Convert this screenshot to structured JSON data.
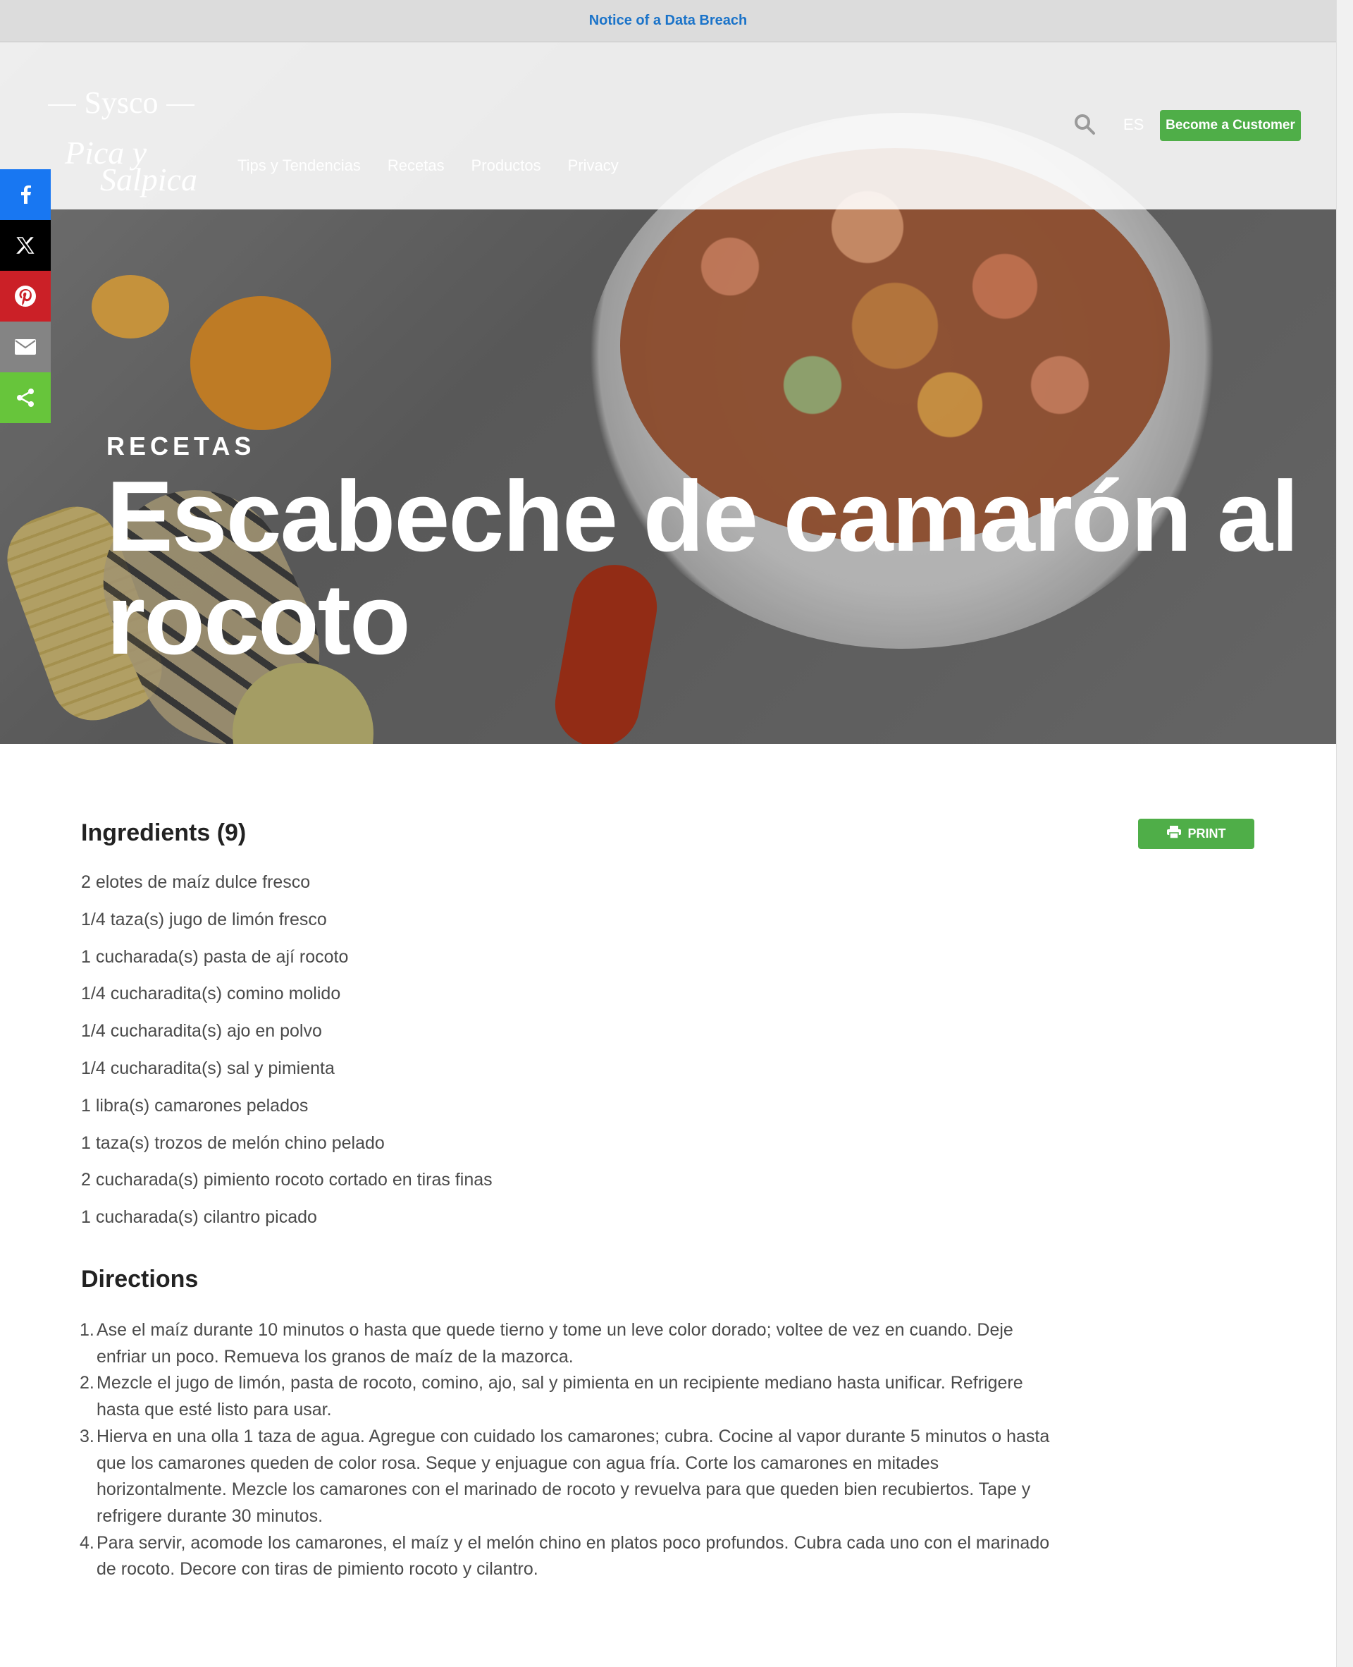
{
  "notice": {
    "label": "Notice of a Data Breach"
  },
  "header": {
    "logo": {
      "line1": "Sysco",
      "line2": "Pica y",
      "line3": "Salpica"
    },
    "nav": [
      "Tips y Tendencias",
      "Recetas",
      "Productos",
      "Privacy"
    ],
    "language": "ES",
    "cta_label": "Become a Customer",
    "search_icon": "search-icon"
  },
  "share": {
    "icons": [
      "facebook-icon",
      "x-icon",
      "pinterest-icon",
      "email-icon",
      "share-icon"
    ],
    "colors": {
      "facebook": "#1877f2",
      "x": "#000000",
      "pinterest": "#cb2027",
      "email": "#848484",
      "share": "#67c53b"
    }
  },
  "hero": {
    "eyebrow": "RECETAS",
    "title": "Escabeche de camarón al rocoto"
  },
  "ingredients": {
    "heading": "Ingredients (9)",
    "print_label": "PRINT",
    "items": [
      "2 elotes de maíz dulce fresco",
      "1/4 taza(s) jugo de limón fresco",
      "1 cucharada(s) pasta de ají rocoto",
      "1/4 cucharadita(s) comino molido",
      "1/4 cucharadita(s) ajo en polvo",
      "1/4 cucharadita(s) sal y pimienta",
      "1 libra(s) camarones pelados",
      "1 taza(s) trozos de melón chino pelado",
      "2 cucharada(s) pimiento rocoto cortado en tiras finas",
      "1 cucharada(s) cilantro picado"
    ]
  },
  "directions": {
    "heading": "Directions",
    "steps": [
      "Ase el maíz durante 10 minutos o hasta que quede tierno y tome un leve color dorado; voltee de vez en cuando. Deje enfriar un poco. Remueva los granos de maíz de la mazorca.",
      "Mezcle el jugo de limón, pasta de rocoto, comino, ajo, sal y pimienta en un recipiente mediano hasta unificar. Refrigere hasta que esté listo para usar.",
      "Hierva en una olla 1 taza de agua. Agregue con cuidado los camarones; cubra. Cocine al vapor durante 5 minutos o hasta que los camarones queden de color rosa. Seque y enjuague con agua fría. Corte los camarones en mitades horizontalmente. Mezcle los camarones con el marinado de rocoto y revuelva para que queden bien recubiertos. Tape y refrigere durante 30 minutos.",
      "Para servir, acomode los camarones, el maíz y el melón chino en platos poco profundos. Cubra cada uno con el marinado de rocoto. Decore con tiras de pimiento rocoto y cilantro."
    ]
  },
  "colors": {
    "accent_green": "#4fae48",
    "notice_link": "#1a73c9"
  }
}
